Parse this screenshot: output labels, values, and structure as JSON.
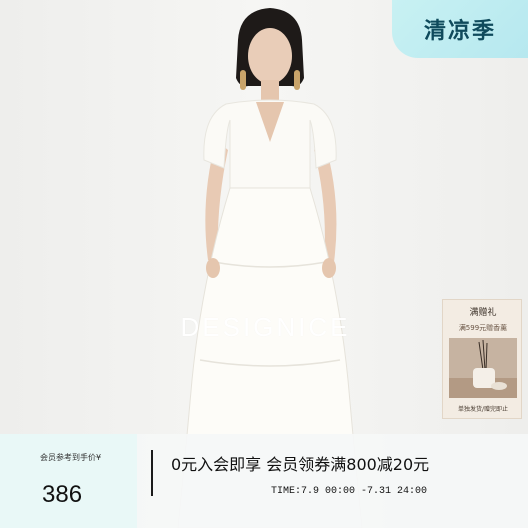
{
  "badge": {
    "text": "清凉季"
  },
  "brand": {
    "name": "DESIGNICE"
  },
  "gift_card": {
    "title": "满赠礼",
    "subtitle": "满599元赠香薰",
    "note": "单独发货/赠完即止"
  },
  "promo": {
    "price_label": "会员参考到手价¥",
    "price": "386",
    "headline": "0元入会即享  会员领券满800减20元",
    "time": "TIME:7.9 00:00 -7.31 24:00"
  },
  "colors": {
    "badge_bg": "#c8f1f3",
    "badge_text": "#0f4a5c",
    "price_panel_bg": "#e9f8f7"
  }
}
